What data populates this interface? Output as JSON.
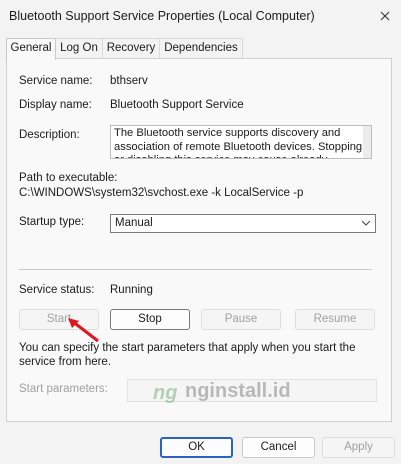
{
  "window": {
    "title": "Bluetooth Support Service Properties (Local Computer)",
    "close_icon": "close-icon"
  },
  "tabs": [
    {
      "label": "General",
      "active": true
    },
    {
      "label": "Log On"
    },
    {
      "label": "Recovery"
    },
    {
      "label": "Dependencies"
    }
  ],
  "general": {
    "service_name_label": "Service name:",
    "service_name": "bthserv",
    "display_name_label": "Display name:",
    "display_name": "Bluetooth Support Service",
    "description_label": "Description:",
    "description": "The Bluetooth service supports discovery and association of remote Bluetooth devices.  Stopping or disabling this service may cause already installed",
    "path_label": "Path to executable:",
    "path": "C:\\WINDOWS\\system32\\svchost.exe -k LocalService -p",
    "startup_type_label": "Startup type:",
    "startup_type": "Manual",
    "service_status_label": "Service status:",
    "service_status": "Running",
    "start_button": "Start",
    "stop_button": "Stop",
    "pause_button": "Pause",
    "resume_button": "Resume",
    "help_text": "You can specify the start parameters that apply when you start the service from here.",
    "start_parameters_label": "Start parameters:",
    "start_parameters_value": ""
  },
  "watermark": {
    "logo_text": "ng",
    "text": "nginstall.id"
  },
  "footer": {
    "ok": "OK",
    "cancel": "Cancel",
    "apply": "Apply"
  },
  "colors": {
    "accent": "#2b62c4",
    "annotation_arrow": "#e0161f"
  }
}
